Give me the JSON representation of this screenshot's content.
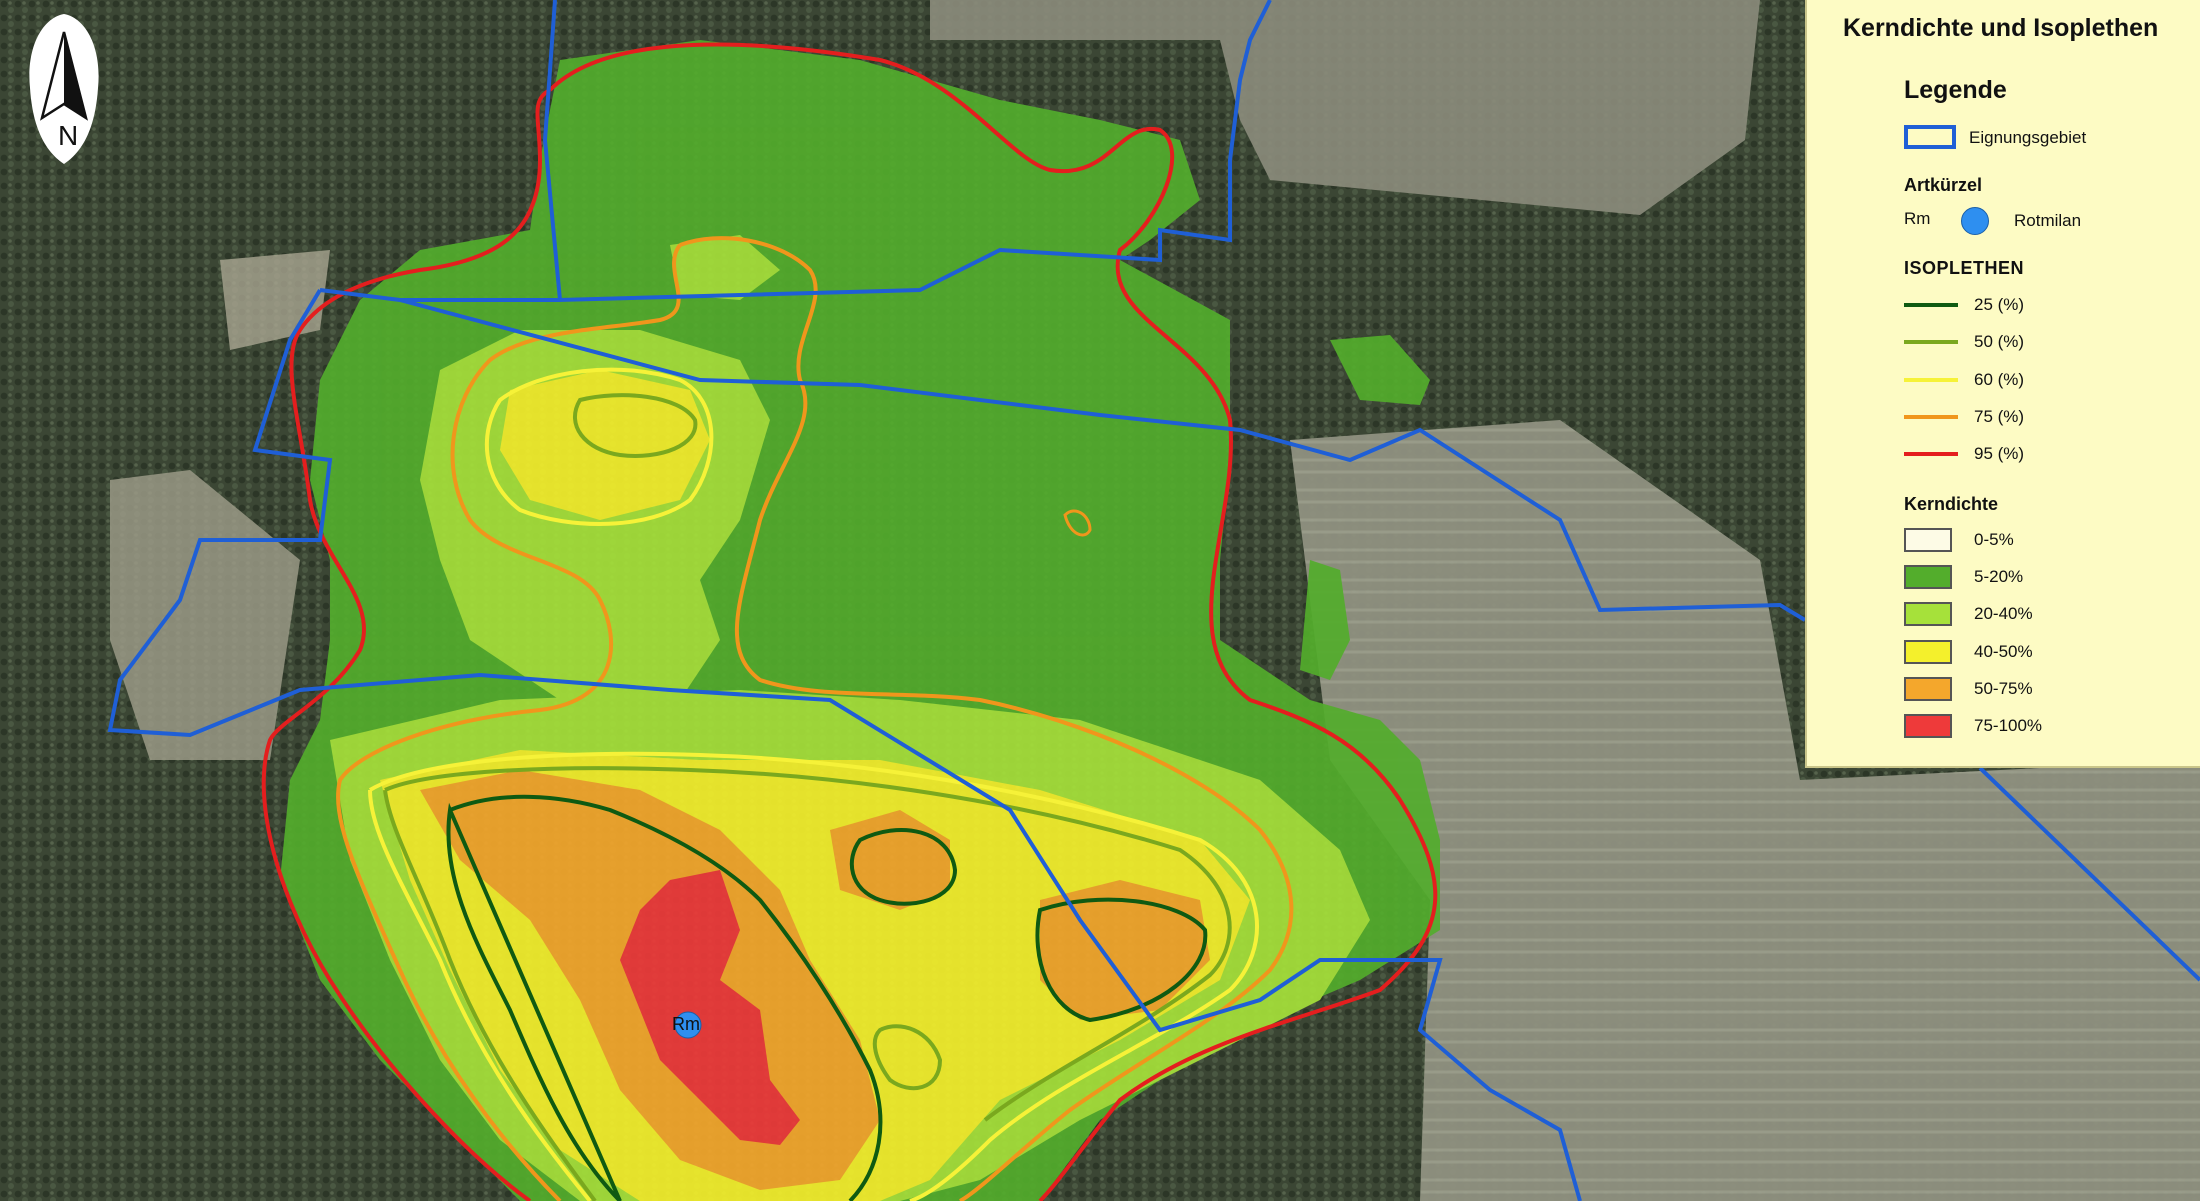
{
  "legend": {
    "title": "Kerndichte und Isoplethen",
    "heading": "Legende",
    "area": {
      "label": "Eignungsgebiet",
      "color": "#1f5fd6"
    },
    "species": {
      "heading": "Artkürzel",
      "code": "Rm",
      "name": "Rotmilan",
      "color": "#2e8ff0"
    },
    "isoplethen": {
      "heading": "ISOPLETHEN",
      "items": [
        {
          "label": "25 (%)",
          "color": "#0f5a12"
        },
        {
          "label": "50 (%)",
          "color": "#7aa81e"
        },
        {
          "label": "60 (%)",
          "color": "#f6f238"
        },
        {
          "label": "75 (%)",
          "color": "#f0961c"
        },
        {
          "label": "95 (%)",
          "color": "#e41e1e"
        }
      ]
    },
    "kerndichte": {
      "heading": "Kerndichte",
      "items": [
        {
          "label": "0-5%",
          "color": "#fdfbe6"
        },
        {
          "label": "5-20%",
          "color": "#53ad2c"
        },
        {
          "label": "20-40%",
          "color": "#a6e13a"
        },
        {
          "label": "40-50%",
          "color": "#f4f02c"
        },
        {
          "label": "50-75%",
          "color": "#f4a72c"
        },
        {
          "label": "75-100%",
          "color": "#ee3a3a"
        }
      ]
    }
  },
  "north_arrow": {
    "letter": "N"
  },
  "map": {
    "point_label": "Rm"
  }
}
